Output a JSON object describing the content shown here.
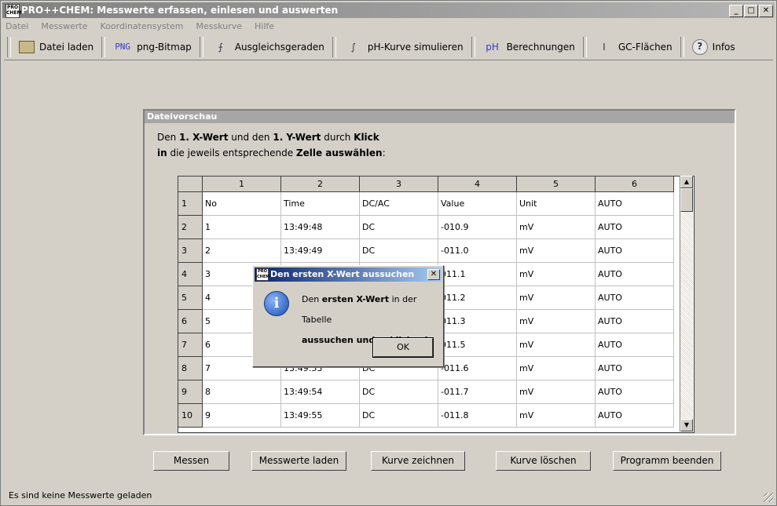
{
  "window": {
    "icon_text": "PRO CHEM",
    "title": "PRO++CHEM: Messwerte erfassen, einlesen und auswerten",
    "btn_min": "_",
    "btn_max": "□",
    "btn_close": "✕"
  },
  "menu": [
    "Datei",
    "Messwerte",
    "Koordinatensystem",
    "Messkurve",
    "Hilfe"
  ],
  "toolbar": [
    {
      "label": "Datei laden",
      "icon": "folder-icon",
      "glyph": ""
    },
    {
      "label": "png-Bitmap",
      "icon": "png-icon",
      "glyph": "PNG"
    },
    {
      "label": "Ausgleichsgeraden",
      "icon": "regression-icon",
      "glyph": "⨍"
    },
    {
      "label": "pH-Kurve simulieren",
      "icon": "ph-curve-icon",
      "glyph": "∫"
    },
    {
      "label": "Berechnungen",
      "icon": "ph-icon",
      "glyph": "pH"
    },
    {
      "label": "GC-Flächen",
      "icon": "integral-icon",
      "glyph": "I"
    },
    {
      "label": "Infos",
      "icon": "help-icon",
      "glyph": "?"
    }
  ],
  "panel": {
    "title": "Dateivorschau",
    "instr1_a": "Den ",
    "instr1_b": "1. X-Wert",
    "instr1_c": " und den ",
    "instr1_d": "1. Y-Wert",
    "instr1_e": " durch ",
    "instr1_f": "Klick",
    "instr2_a": "in",
    "instr2_b": " die jeweils entsprechende ",
    "instr2_c": "Zelle auswählen",
    "instr2_d": ":"
  },
  "grid": {
    "col_headers": [
      "1",
      "2",
      "3",
      "4",
      "5",
      "6"
    ],
    "row_headers": [
      "1",
      "2",
      "3",
      "4",
      "5",
      "6",
      "7",
      "8",
      "9",
      "10"
    ],
    "rows": [
      [
        "No",
        "Time",
        "DC/AC",
        "Value",
        "Unit",
        "AUTO"
      ],
      [
        "1",
        "13:49:48",
        "DC",
        "-010.9",
        "mV",
        "AUTO"
      ],
      [
        "2",
        "13:49:49",
        "DC",
        "-011.0",
        "mV",
        "AUTO"
      ],
      [
        "3",
        "",
        "",
        "011.1",
        "mV",
        "AUTO"
      ],
      [
        "4",
        "",
        "",
        "011.2",
        "mV",
        "AUTO"
      ],
      [
        "5",
        "",
        "",
        "011.3",
        "mV",
        "AUTO"
      ],
      [
        "6",
        "",
        "",
        "011.5",
        "mV",
        "AUTO"
      ],
      [
        "7",
        "13:49:53",
        "DC",
        "-011.6",
        "mV",
        "AUTO"
      ],
      [
        "8",
        "13:49:54",
        "DC",
        "-011.7",
        "mV",
        "AUTO"
      ],
      [
        "9",
        "13:49:55",
        "DC",
        "-011.8",
        "mV",
        "AUTO"
      ]
    ],
    "scroll_up": "▲",
    "scroll_down": "▼"
  },
  "dialog": {
    "icon_text": "PRO CHEM",
    "title": "Den ersten X-Wert aussuchen",
    "close": "✕",
    "info_glyph": "i",
    "line1_a": "Den ",
    "line1_b": "ersten X-Wert",
    "line1_c": " in der Tabelle",
    "line2": "aussuchen und anklicken!",
    "ok": "OK"
  },
  "buttons": [
    "Messen",
    "Messwerte laden",
    "Kurve zeichnen",
    "Kurve löschen",
    "Programm beenden"
  ],
  "status": "Es sind keine Messwerte geladen"
}
